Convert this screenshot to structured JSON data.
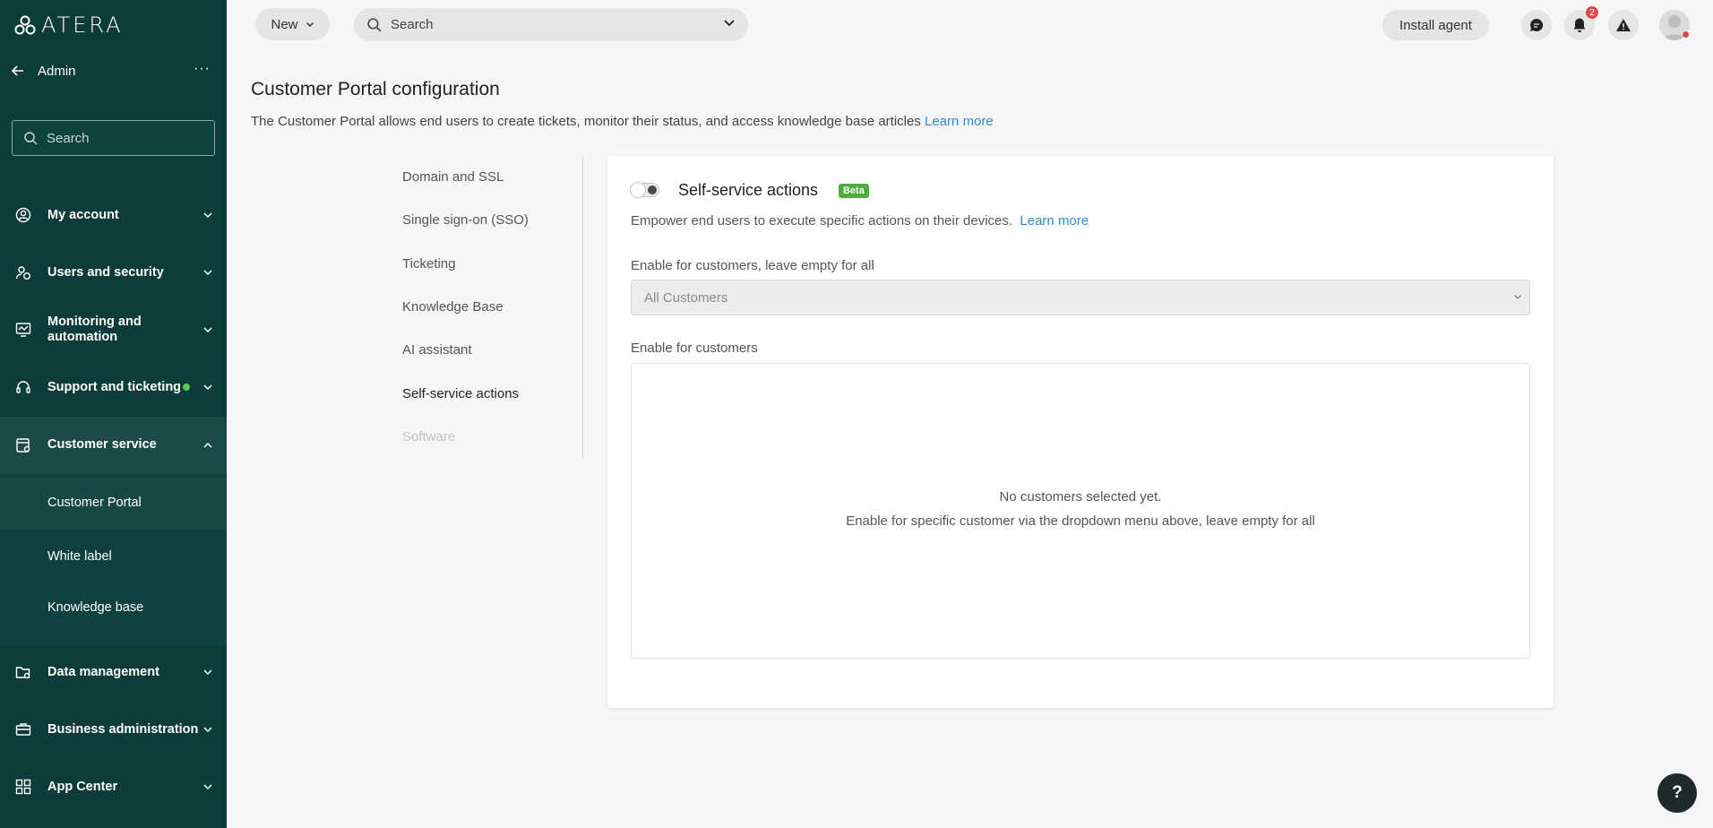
{
  "sidebar": {
    "logo_text": "ATERA",
    "admin_label": "Admin",
    "more_label": "···",
    "search_placeholder": "Search",
    "items": [
      {
        "label": "My account",
        "icon": "user-circle-icon"
      },
      {
        "label": "Users and security",
        "icon": "users-security-icon"
      },
      {
        "label": "Monitoring and automation",
        "icon": "monitor-icon"
      },
      {
        "label": "Support and ticketing",
        "icon": "headset-icon"
      },
      {
        "label": "Customer service",
        "icon": "customer-service-icon"
      },
      {
        "label": "Data management",
        "icon": "folder-gear-icon"
      },
      {
        "label": "Business administration",
        "icon": "briefcase-icon"
      },
      {
        "label": "App Center",
        "icon": "apps-icon"
      }
    ],
    "sub_items": [
      {
        "label": "Customer Portal"
      },
      {
        "label": "White label"
      },
      {
        "label": "Knowledge base"
      }
    ]
  },
  "topbar": {
    "new_label": "New",
    "search_placeholder": "Search",
    "install_agent_label": "Install agent",
    "notifications_count": "2",
    "help_label": "?"
  },
  "page": {
    "title": "Customer Portal configuration",
    "description": "The Customer Portal allows end users to create tickets, monitor their status, and access knowledge base articles",
    "learn_more": "Learn more"
  },
  "inner_nav": [
    {
      "label": "Domain and SSL"
    },
    {
      "label": "Single sign-on (SSO)"
    },
    {
      "label": "Ticketing"
    },
    {
      "label": "Knowledge Base"
    },
    {
      "label": "AI assistant"
    },
    {
      "label": "Self-service actions"
    },
    {
      "label": "Software"
    }
  ],
  "card": {
    "title": "Self-service actions",
    "beta": "Beta",
    "description": "Empower end users to execute specific actions on their devices.",
    "learn_more": "Learn more",
    "select_label": "Enable for customers, leave empty for all",
    "select_value": "All Customers",
    "list_label": "Enable for customers",
    "empty_line1": "No customers selected yet.",
    "empty_line2": "Enable for specific customer via the dropdown menu above, leave empty for all"
  },
  "colors": {
    "sidebar_bg": "#0d3c3a",
    "link": "#2f8ccc",
    "beta": "#4caf3a",
    "status_dot": "#5cc94d",
    "badge": "#e04848"
  }
}
